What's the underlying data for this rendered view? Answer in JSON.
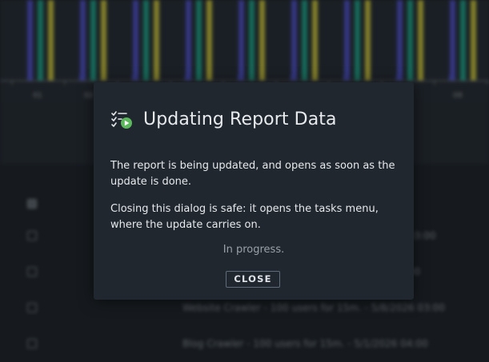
{
  "dialog": {
    "title": "Updating Report Data",
    "paragraph1": "The report is being updated, and opens as soon as the update is done.",
    "paragraph2": "Closing this dialog is safe: it opens the tasks menu, where the update carries on.",
    "status": "In progress.",
    "close_label": "CLOSE",
    "icon": "tasks-list-play-icon",
    "accent_color": "#5cb85c"
  },
  "background": {
    "chart": {
      "tick_labels": [
        "01",
        "02",
        "09"
      ],
      "series_colors": [
        "#4d4fc4",
        "#1fa187",
        "#c9c33a"
      ]
    },
    "table_rows": [
      {
        "text": "",
        "checked": true
      },
      {
        "text": "03:00",
        "checked": false
      },
      {
        "text": "00",
        "checked": false
      },
      {
        "text": "Website Crawler - 100 users for 15m. - 5/8/2026 03:00",
        "checked": false
      },
      {
        "text": "Blog Crawler - 100 users for 15m. - 5/1/2026 04:00",
        "checked": false
      }
    ]
  }
}
